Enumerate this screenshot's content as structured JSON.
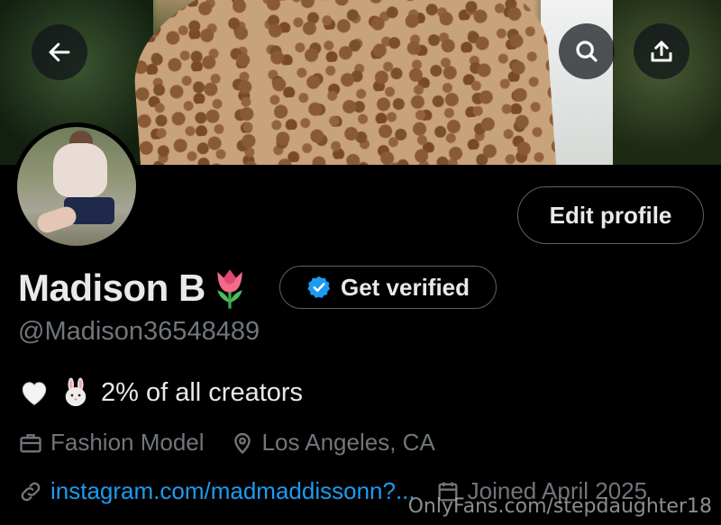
{
  "header": {
    "back_icon": "arrow-left-icon",
    "search_icon": "search-icon",
    "share_icon": "share-upload-icon"
  },
  "profile": {
    "display_name": "Madison B",
    "name_emoji": "tulip-emoji",
    "handle": "@Madison36548489",
    "edit_label": "Edit profile",
    "verify_label": "Get verified",
    "bio": {
      "emoji": [
        "white-heart-emoji",
        "rabbit-face-emoji"
      ],
      "text": "2% of all creators"
    },
    "profession": "Fashion Model",
    "location": "Los Angeles, CA",
    "link": "instagram.com/madmaddissonn?...",
    "joined": "Joined April 2025"
  },
  "watermark": "OnlyFans.com/stepdaughter18",
  "colors": {
    "background": "#000000",
    "text": "#e7e9ea",
    "muted": "#71767b",
    "link": "#1d9bf0",
    "border": "#536471",
    "verified_badge": "#1d9bf0"
  }
}
